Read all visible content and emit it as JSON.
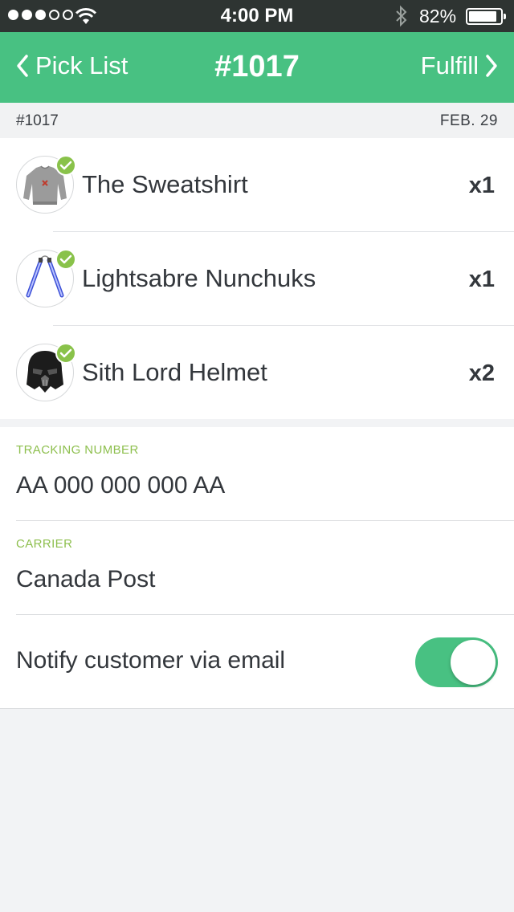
{
  "status_bar": {
    "time": "4:00 PM",
    "battery": "82%"
  },
  "nav": {
    "back_label": "Pick List",
    "title": "#1017",
    "forward_label": "Fulfill"
  },
  "order": {
    "number": "#1017",
    "date": "FEB. 29"
  },
  "items": [
    {
      "name": "The Sweatshirt",
      "qty": "x1",
      "icon": "sweatshirt-icon"
    },
    {
      "name": "Lightsabre Nunchuks",
      "qty": "x1",
      "icon": "nunchuks-icon"
    },
    {
      "name": "Sith Lord Helmet",
      "qty": "x2",
      "icon": "helmet-icon"
    }
  ],
  "shipping": {
    "tracking_label": "TRACKING NUMBER",
    "tracking_value": "AA 000 000 000 AA",
    "carrier_label": "CARRIER",
    "carrier_value": "Canada Post",
    "notify_label": "Notify customer via email",
    "notify_enabled": true
  },
  "colors": {
    "accent": "#48c182",
    "check": "#89c24a",
    "field_label": "#8dbf4d",
    "status_bar": "#2e3432"
  }
}
